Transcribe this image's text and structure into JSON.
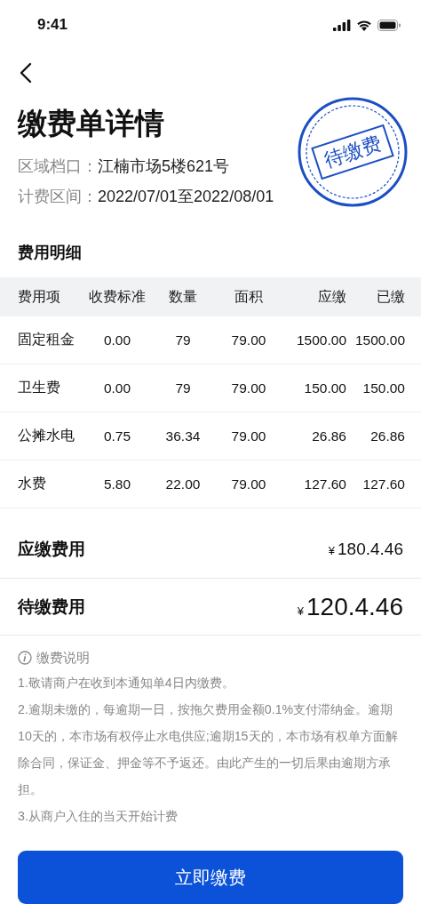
{
  "status_bar": {
    "time": "9:41"
  },
  "header": {
    "title": "缴费单详情",
    "stamp": "待缴费",
    "info": [
      {
        "label": "区域档口：",
        "value": "江楠市场5楼621号"
      },
      {
        "label": "计费区间：",
        "value": "2022/07/01至2022/08/01"
      }
    ]
  },
  "fee_table": {
    "title": "费用明细",
    "columns": [
      "费用项",
      "收费标准",
      "数量",
      "面积",
      "应缴",
      "已缴"
    ],
    "rows": [
      [
        "固定租金",
        "0.00",
        "79",
        "79.00",
        "1500.00",
        "1500.00"
      ],
      [
        "卫生费",
        "0.00",
        "79",
        "79.00",
        "150.00",
        "150.00"
      ],
      [
        "公摊水电",
        "0.75",
        "36.34",
        "79.00",
        "26.86",
        "26.86"
      ],
      [
        "水费",
        "5.80",
        "22.00",
        "79.00",
        "127.60",
        "127.60"
      ]
    ]
  },
  "summary": [
    {
      "label": "应缴费用",
      "currency": "¥",
      "amount": "180.4.46",
      "kind": "normal"
    },
    {
      "label": "待缴费用",
      "currency": "¥",
      "amount": "120.4.46",
      "kind": "large"
    }
  ],
  "notes": {
    "title": "缴费说明",
    "lines": [
      "1.敬请商户在收到本通知单4日内缴费。",
      "2.逾期未缴的，每逾期一日，按拖欠费用金额0.1%支付滞纳金。逾期10天的，本市场有权停止水电供应;逾期15天的，本市场有权单方面解除合同，保证金、押金等不予返还。由此产生的一切后果由逾期方承担。",
      "3.从商户入住的当天开始计费"
    ]
  },
  "pay_button": "立即缴费"
}
